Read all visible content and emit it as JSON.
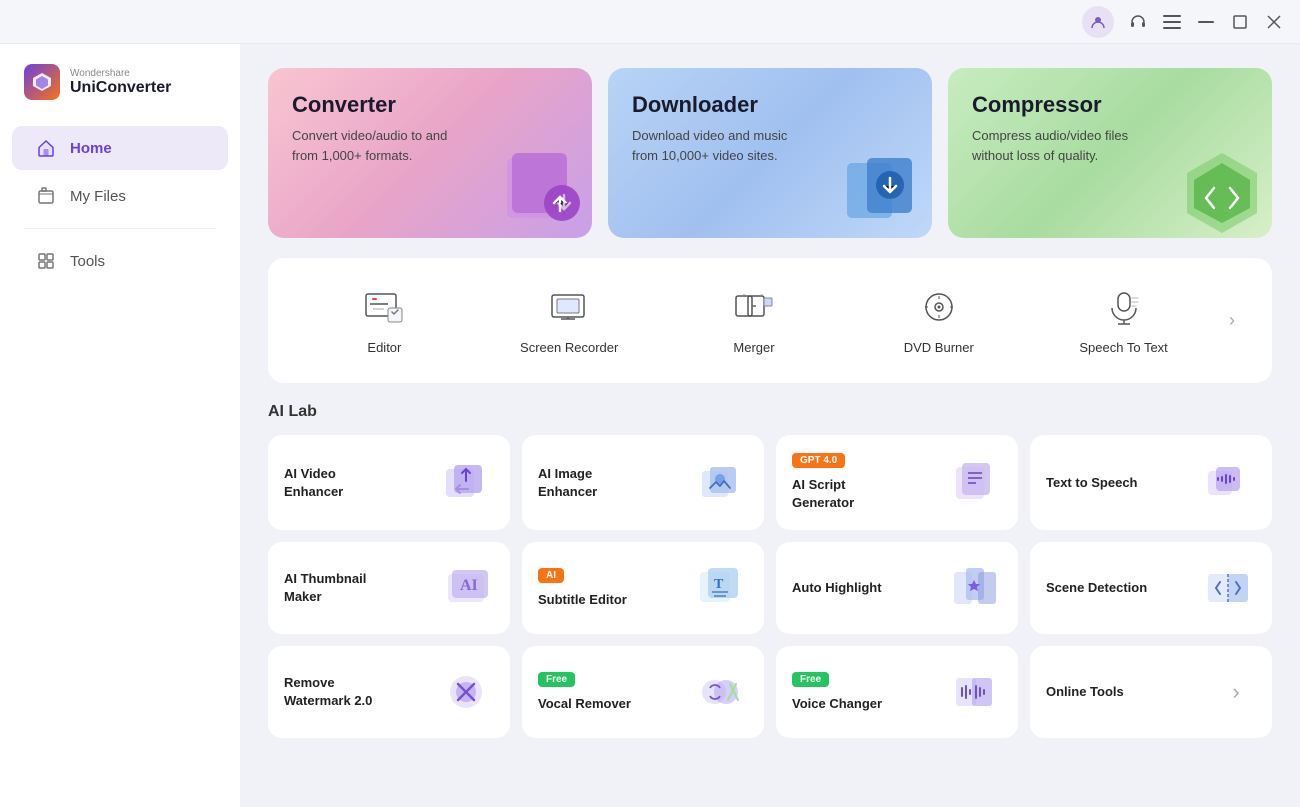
{
  "app": {
    "brand": "Wondershare",
    "name": "UniConverter"
  },
  "titlebar": {
    "profile_label": "👤",
    "headset_label": "🎧",
    "menu_label": "≡",
    "minimize_label": "—",
    "maximize_label": "□",
    "close_label": "✕"
  },
  "sidebar": {
    "home_label": "Home",
    "my_files_label": "My Files",
    "tools_label": "Tools"
  },
  "hero_cards": [
    {
      "id": "converter",
      "title": "Converter",
      "desc": "Convert video/audio to and from 1,000+ formats."
    },
    {
      "id": "downloader",
      "title": "Downloader",
      "desc": "Download video and music from 10,000+ video sites."
    },
    {
      "id": "compressor",
      "title": "Compressor",
      "desc": "Compress audio/video files without loss of quality."
    }
  ],
  "tools": [
    {
      "id": "editor",
      "label": "Editor"
    },
    {
      "id": "screen-recorder",
      "label": "Screen Recorder"
    },
    {
      "id": "merger",
      "label": "Merger"
    },
    {
      "id": "dvd-burner",
      "label": "DVD Burner"
    },
    {
      "id": "speech-to-text",
      "label": "Speech To Text"
    }
  ],
  "ai_lab": {
    "title": "AI Lab",
    "items": [
      {
        "id": "ai-video-enhancer",
        "name": "AI Video\nEnhancer",
        "badge": null
      },
      {
        "id": "ai-image-enhancer",
        "name": "AI Image\nEnhancer",
        "badge": null
      },
      {
        "id": "ai-script-generator",
        "name": "AI Script\nGenerator",
        "badge": "GPT 4.0",
        "badge_type": "gpt"
      },
      {
        "id": "text-to-speech",
        "name": "Text to Speech",
        "badge": null
      },
      {
        "id": "ai-thumbnail-maker",
        "name": "AI Thumbnail\nMaker",
        "badge": null
      },
      {
        "id": "subtitle-editor",
        "name": "Subtitle Editor",
        "badge": "AI",
        "badge_type": "ai"
      },
      {
        "id": "auto-highlight",
        "name": "Auto Highlight",
        "badge": null
      },
      {
        "id": "scene-detection",
        "name": "Scene Detection",
        "badge": null
      },
      {
        "id": "remove-watermark",
        "name": "Remove\nWatermark 2.0",
        "badge": null
      },
      {
        "id": "vocal-remover",
        "name": "Vocal Remover",
        "badge": "Free",
        "badge_type": "free"
      },
      {
        "id": "voice-changer",
        "name": "Voice Changer",
        "badge": "Free",
        "badge_type": "free"
      },
      {
        "id": "online-tools",
        "name": "Online Tools",
        "badge": null,
        "has_arrow": true
      }
    ]
  }
}
